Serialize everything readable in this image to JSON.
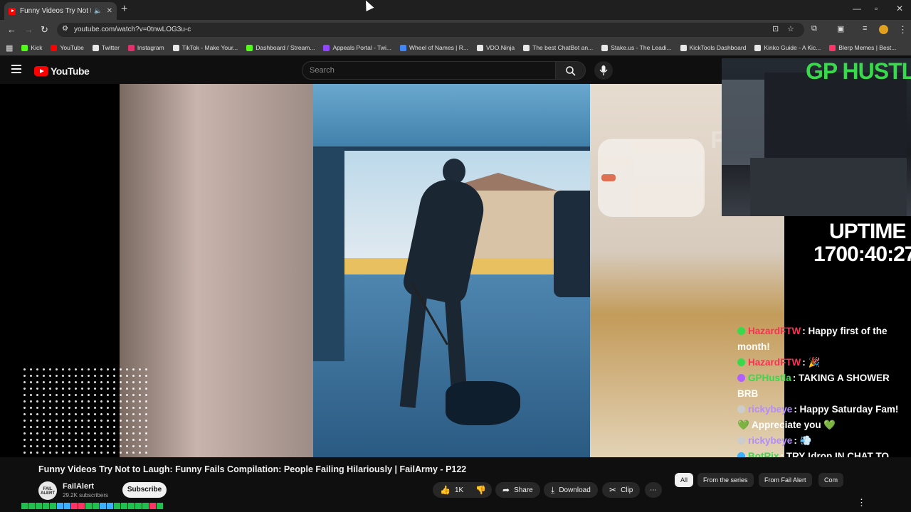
{
  "browser": {
    "tab_title": "Funny Videos Try Not to Laugh",
    "url": "youtube.com/watch?v=0tnwLOG3u-c",
    "bookmarks": [
      {
        "label": "Kick",
        "color": "#53fc18"
      },
      {
        "label": "YouTube",
        "color": "#ff0000"
      },
      {
        "label": "Twitter",
        "color": "#e8e8e8"
      },
      {
        "label": "Instagram",
        "color": "#e1306c"
      },
      {
        "label": "TikTok - Make Your...",
        "color": "#e8e8e8"
      },
      {
        "label": "Dashboard / Stream...",
        "color": "#53fc18"
      },
      {
        "label": "Appeals Portal - Twi...",
        "color": "#9146ff"
      },
      {
        "label": "Wheel of Names | R...",
        "color": "#4285f4"
      },
      {
        "label": "VDO.Ninja",
        "color": "#e8e8e8"
      },
      {
        "label": "The best ChatBot an...",
        "color": "#e8e8e8"
      },
      {
        "label": "Stake.us - The Leadi...",
        "color": "#e8e8e8"
      },
      {
        "label": "KickTools Dashboard",
        "color": "#e8e8e8"
      },
      {
        "label": "Kinko Guide - A Kic...",
        "color": "#e8e8e8"
      },
      {
        "label": "Blerp Memes | Best...",
        "color": "#ff3366"
      }
    ]
  },
  "youtube": {
    "logo_text": "YouTube",
    "search_placeholder": "Search",
    "video_title": "Funny Videos Try Not to Laugh: Funny Fails Compilation: People Failing Hilariously | FailArmy - P122",
    "channel_name": "FailAlert",
    "channel_subs": "29.2K subscribers",
    "channel_avatar_text": "FAIL ALERT",
    "subscribe_label": "Subscribe",
    "like_count": "1K",
    "share_label": "Share",
    "download_label": "Download",
    "clip_label": "Clip",
    "chips": [
      "All",
      "From the series",
      "From Fail Alert",
      "Com"
    ],
    "watermark": "F AL"
  },
  "overlay": {
    "streamer_name": "GP HUSTLA",
    "uptime_label": "UPTIME",
    "uptime_value": "1700:40:27",
    "chat": [
      {
        "user": "HazardFTW",
        "color": "#ff2e55",
        "badge": "#38d94a",
        "text": ": Happy first of the month!"
      },
      {
        "user": "HazardFTW",
        "color": "#ff2e55",
        "badge": "#38d94a",
        "text": ": 🎉"
      },
      {
        "user": "GPHustla",
        "color": "#38d94a",
        "badge": "#b060ff",
        "text": ": TAKING A SHOWER BRB"
      },
      {
        "user": "rickybeye",
        "color": "#b48cff",
        "badge": "#cccccc",
        "text": ": Happy Saturday Fam! 💚 Appreciate you 💚"
      },
      {
        "user": "rickybeye",
        "color": "#b48cff",
        "badge": "#cccccc",
        "text": ": 💨"
      },
      {
        "user": "BotRix",
        "color": "#38d94a",
        "badge": "#3ab0ff",
        "text": ": TRY !drop IN CHAT TO DROP A KINKO BALL ON SCREEN! GOOD LUCK!"
      }
    ]
  },
  "colors": {
    "yt_red": "#ff0000",
    "overlay_green": "#38d94a",
    "page_bg": "#0f0f0f"
  }
}
